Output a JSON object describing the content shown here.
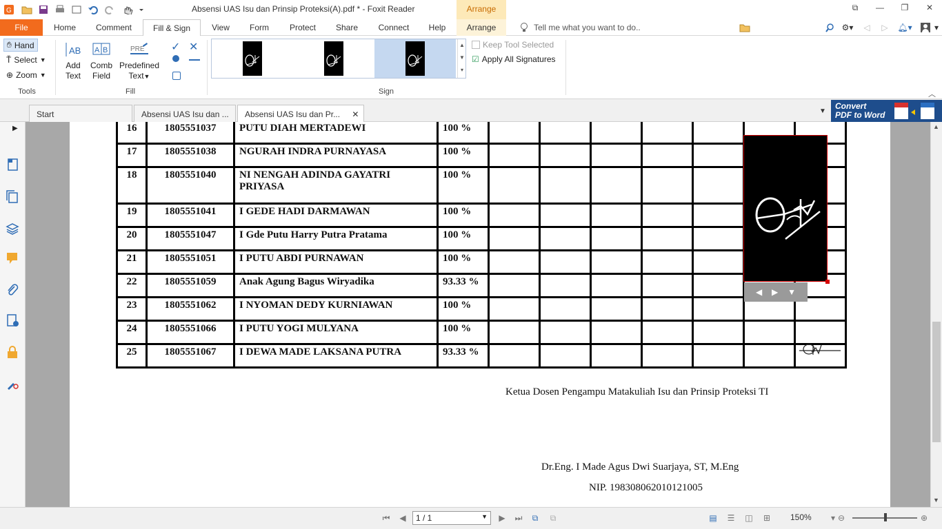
{
  "app": {
    "window_title": "Absensi UAS Isu dan Prinsip Proteksi(A).pdf * - Foxit Reader",
    "context_tab": "Arrange"
  },
  "menu": {
    "file": "File",
    "home": "Home",
    "comment": "Comment",
    "fill_sign": "Fill & Sign",
    "view": "View",
    "form": "Form",
    "protect": "Protect",
    "share": "Share",
    "connect": "Connect",
    "help": "Help",
    "arrange": "Arrange",
    "tell_me": "Tell me what you want to do..",
    "find_placeholder": "Find"
  },
  "ribbon": {
    "tools": {
      "hand": "Hand",
      "select": "Select",
      "zoom": "Zoom",
      "label": "Tools"
    },
    "fill": {
      "add_text_1": "Add",
      "add_text_2": "Text",
      "comb_1": "Comb",
      "comb_2": "Field",
      "predef_1": "Predefined",
      "predef_2": "Text",
      "label": "Fill"
    },
    "sign": {
      "label": "Sign",
      "keep_tool": "Keep Tool Selected",
      "apply_all": "Apply All Signatures"
    }
  },
  "tabs": [
    {
      "label": "Start"
    },
    {
      "label": "Absensi UAS Isu dan ..."
    },
    {
      "label": "Absensi UAS Isu dan Pr..."
    }
  ],
  "convert": {
    "line1": "Convert",
    "line2": "PDF to Word"
  },
  "table_rows": [
    {
      "no": "16",
      "nim": "1805551037",
      "name": "PUTU DIAH MERTADEWI",
      "pct": "100 %"
    },
    {
      "no": "17",
      "nim": "1805551038",
      "name": "NGURAH INDRA PURNAYASA",
      "pct": "100 %"
    },
    {
      "no": "18",
      "nim": "1805551040",
      "name": "NI NENGAH ADINDA GAYATRI PRIYASA",
      "pct": "100 %"
    },
    {
      "no": "19",
      "nim": "1805551041",
      "name": "I GEDE HADI DARMAWAN",
      "pct": "100 %"
    },
    {
      "no": "20",
      "nim": "1805551047",
      "name": "I Gde Putu Harry Putra Pratama",
      "pct": "100 %"
    },
    {
      "no": "21",
      "nim": "1805551051",
      "name": "I PUTU ABDI PURNAWAN",
      "pct": "100 %"
    },
    {
      "no": "22",
      "nim": "1805551059",
      "name": "Anak Agung Bagus Wiryadika",
      "pct": "93.33 %"
    },
    {
      "no": "23",
      "nim": "1805551062",
      "name": "I NYOMAN DEDY KURNIAWAN",
      "pct": "100 %"
    },
    {
      "no": "24",
      "nim": "1805551066",
      "name": "I PUTU YOGI MULYANA",
      "pct": "100 %"
    },
    {
      "no": "25",
      "nim": "1805551067",
      "name": "I DEWA MADE LAKSANA PUTRA",
      "pct": "93.33 %"
    }
  ],
  "footer": {
    "ketua": "Ketua Dosen Pengampu Matakuliah Isu dan Prinsip Proteksi TI",
    "name": "Dr.Eng. I Made Agus Dwi Suarjaya, ST, M.Eng",
    "nip": "NIP. 198308062010121005"
  },
  "status": {
    "page": "1 / 1",
    "zoom": "150%"
  },
  "colors": {
    "file_tab": "#f26b1d",
    "arrange_tab": "#fde9b8",
    "convert_banner": "#1e4d8c",
    "sig_border": "#d60000"
  }
}
